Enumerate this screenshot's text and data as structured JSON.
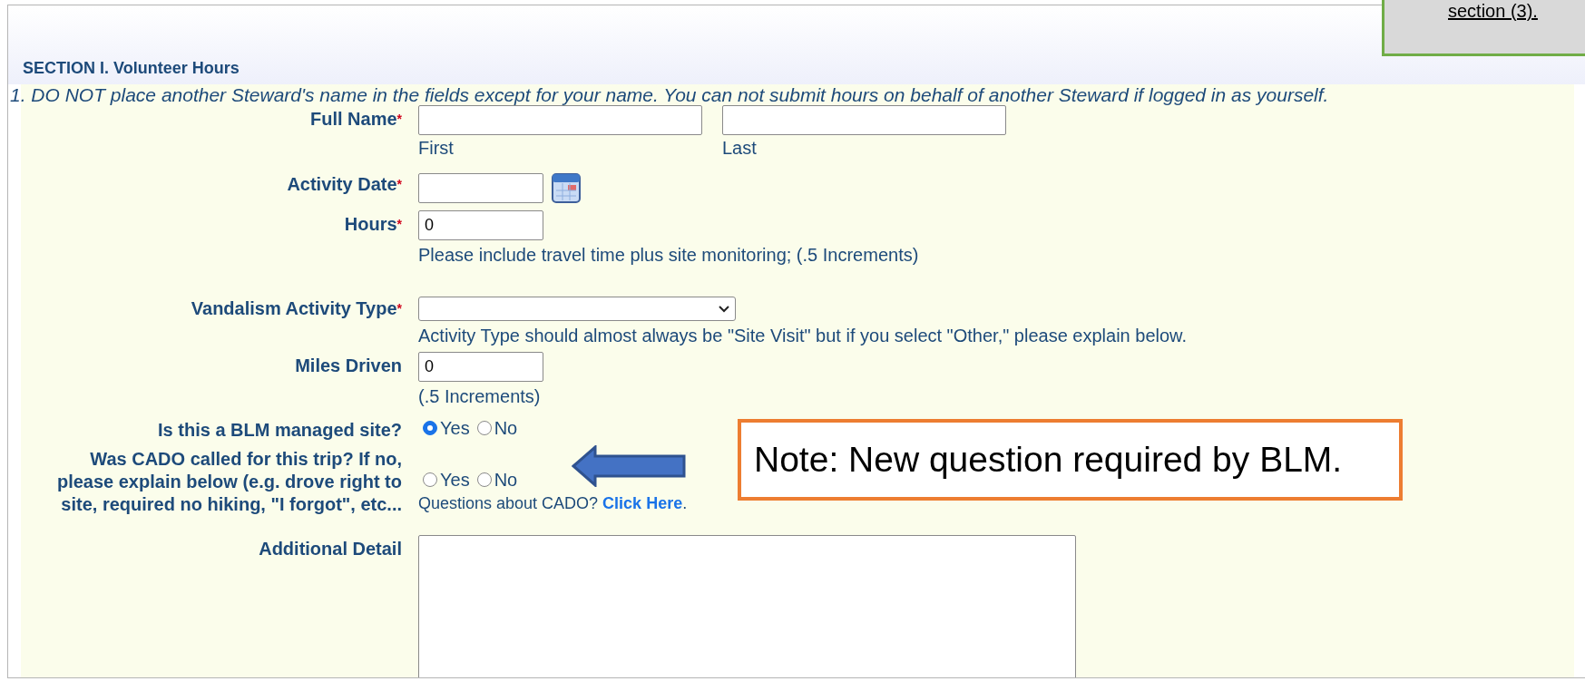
{
  "callout": {
    "text": "section (3)."
  },
  "section": {
    "title": "SECTION I. Volunteer Hours",
    "instruction": "1. DO NOT place another Steward's name in the fields except for your name. You can not submit hours on behalf of another Steward if logged in as yourself."
  },
  "required_marker": "*",
  "fields": [
    {
      "kind": "name",
      "label": "Full Name",
      "required": true,
      "first_hint": "First",
      "last_hint": "Last"
    },
    {
      "kind": "date",
      "label": "Activity Date",
      "required": true
    },
    {
      "kind": "text",
      "label": "Hours",
      "required": true,
      "value": "0",
      "help": "Please include travel time plus site monitoring; (.5 Increments)"
    },
    {
      "kind": "select",
      "label": "Vandalism Activity Type",
      "required": true,
      "help": "Activity Type should almost always be \"Site Visit\" but if you select \"Other,\" please explain below."
    },
    {
      "kind": "text",
      "label": "Miles Driven",
      "required": false,
      "value": "0",
      "help": "(.5 Increments)"
    },
    {
      "kind": "radio",
      "label": "Is this a BLM managed site?",
      "required": false,
      "options": [
        {
          "label": "Yes",
          "selected": true
        },
        {
          "label": "No",
          "selected": false
        }
      ]
    },
    {
      "kind": "radio",
      "label": "Was CADO called for this trip? If no, please explain below (e.g. drove right to site, required no hiking, \"I forgot\", etc...",
      "required": false,
      "options": [
        {
          "label": "Yes",
          "selected": false
        },
        {
          "label": "No",
          "selected": false
        }
      ],
      "help": "Questions about CADO?",
      "link": "Click Here",
      "after": "."
    },
    {
      "kind": "textarea",
      "label": "Additional Detail",
      "required": false
    }
  ],
  "note": {
    "text": "Note: New question required by BLM."
  }
}
